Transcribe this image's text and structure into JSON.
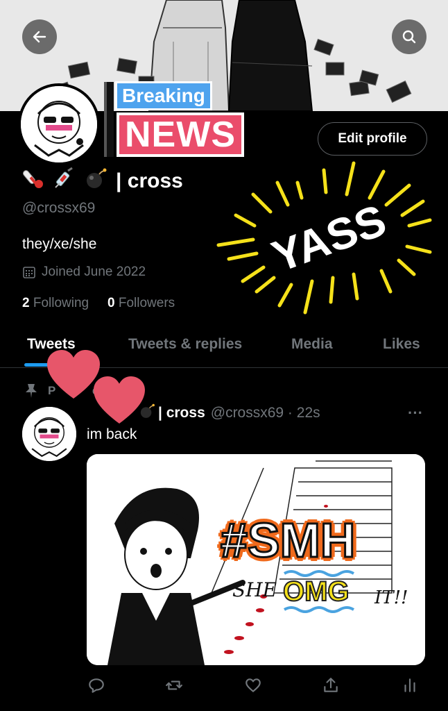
{
  "header": {
    "back_icon": "arrow-left-icon",
    "search_icon": "search-icon"
  },
  "stickers": {
    "breaking": "Breaking",
    "news": "NEWS",
    "yass": "YASS",
    "smh": "#SMH",
    "omg": "OMG"
  },
  "profile": {
    "edit_label": "Edit profile",
    "name_text": "| cross",
    "emojis": [
      "thermometer",
      "syringe",
      "bomb"
    ],
    "handle": "@crossx69",
    "bio": "they/xe/she",
    "joined": "Joined June 2022",
    "following_count": "2",
    "following_label": "Following",
    "followers_count": "0",
    "followers_label": "Followers"
  },
  "tabs": [
    {
      "label": "Tweets",
      "active": true
    },
    {
      "label": "Tweets & replies",
      "active": false
    },
    {
      "label": "Media",
      "active": false
    },
    {
      "label": "Likes",
      "active": false
    }
  ],
  "tweet": {
    "pinned_label": "Pinned Tweet",
    "pinned_visible": "P    d     et",
    "name": "| cross",
    "handle_time": "@crossx69 · 22s",
    "text": "im back",
    "more": "···",
    "image_caption": "SHE",
    "image_caption2": "IT!!"
  },
  "colors": {
    "accent": "#1d9bf0",
    "heart": "#e7566a",
    "sticker_yellow": "#f5e11a",
    "news_pink": "#ea4d6b"
  }
}
